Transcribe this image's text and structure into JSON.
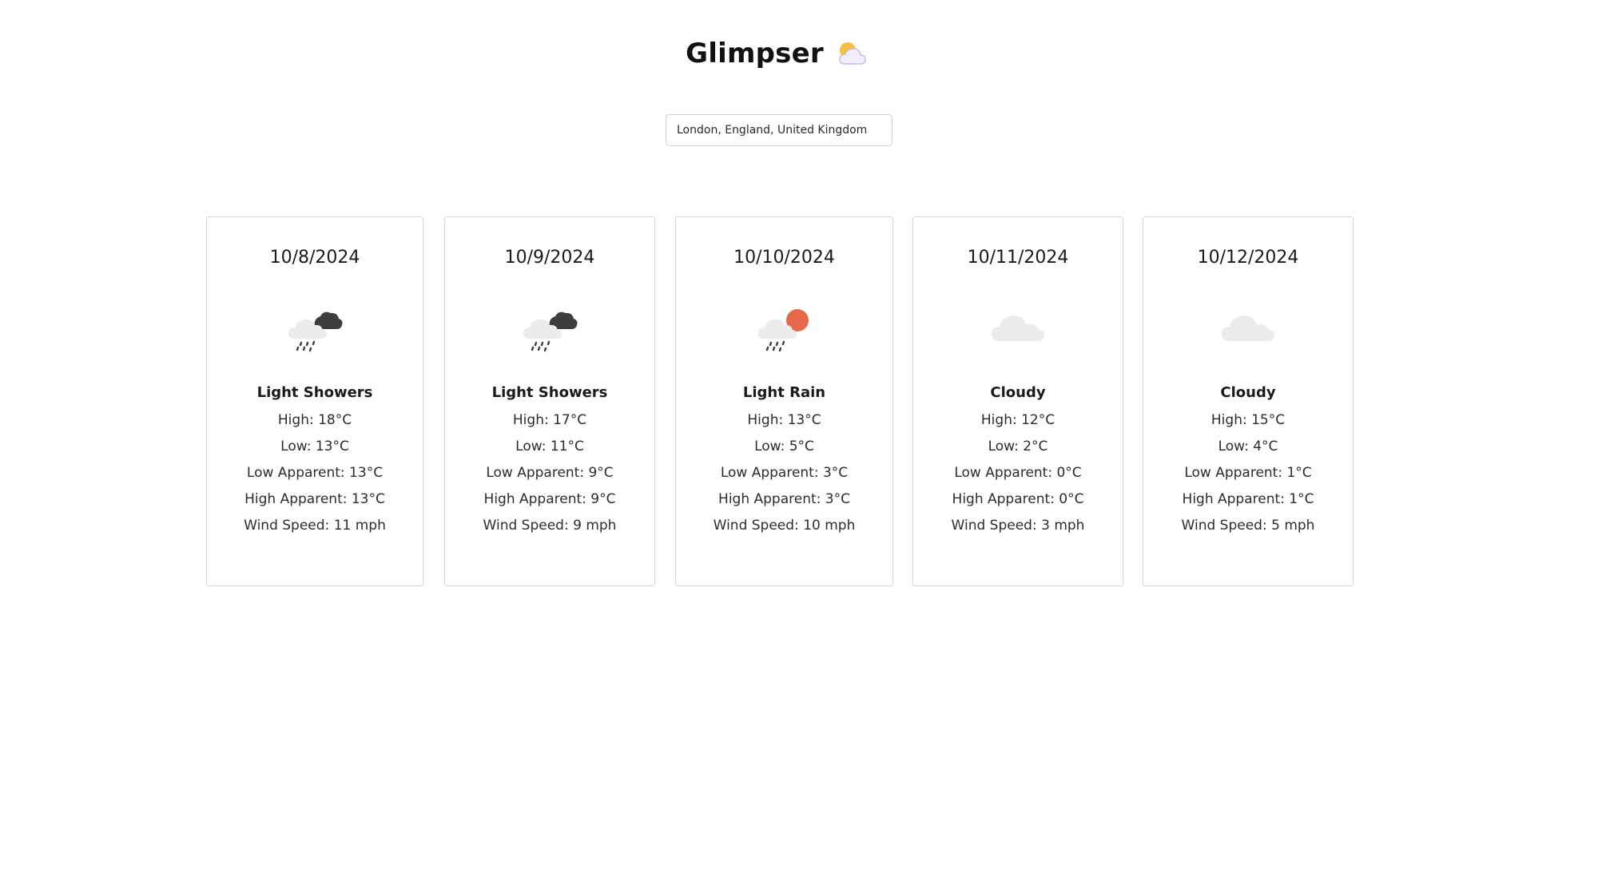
{
  "header": {
    "title": "Glimpser",
    "icon": "sun-behind-cloud-icon"
  },
  "search": {
    "value": "London, England, United Kingdom"
  },
  "labels": {
    "high": "High: ",
    "low": "Low: ",
    "low_apparent": "Low Apparent: ",
    "high_apparent": "High Apparent: ",
    "wind_speed": "Wind Speed: "
  },
  "forecast": [
    {
      "date": "10/8/2024",
      "icon": "heavy-cloud-rain-icon",
      "condition": "Light Showers",
      "high": "High: 18°C",
      "low": "Low: 13°C",
      "low_apparent": "Low Apparent: 13°C",
      "high_apparent": "High Apparent: 13°C",
      "wind_speed": "Wind Speed: 11 mph"
    },
    {
      "date": "10/9/2024",
      "icon": "heavy-cloud-rain-icon",
      "condition": "Light Showers",
      "high": "High: 17°C",
      "low": "Low: 11°C",
      "low_apparent": "Low Apparent: 9°C",
      "high_apparent": "High Apparent: 9°C",
      "wind_speed": "Wind Speed: 9 mph"
    },
    {
      "date": "10/10/2024",
      "icon": "sun-cloud-rain-icon",
      "condition": "Light Rain",
      "high": "High: 13°C",
      "low": "Low: 5°C",
      "low_apparent": "Low Apparent: 3°C",
      "high_apparent": "High Apparent: 3°C",
      "wind_speed": "Wind Speed: 10 mph"
    },
    {
      "date": "10/11/2024",
      "icon": "cloud-icon",
      "condition": "Cloudy",
      "high": "High: 12°C",
      "low": "Low: 2°C",
      "low_apparent": "Low Apparent: 0°C",
      "high_apparent": "High Apparent: 0°C",
      "wind_speed": "Wind Speed: 3 mph"
    },
    {
      "date": "10/12/2024",
      "icon": "cloud-icon",
      "condition": "Cloudy",
      "high": "High: 15°C",
      "low": "Low: 4°C",
      "low_apparent": "Low Apparent: 1°C",
      "high_apparent": "High Apparent: 1°C",
      "wind_speed": "Wind Speed: 5 mph"
    }
  ],
  "colors": {
    "card_border": "#d8d8d8",
    "sun_orange": "#e8684a",
    "dark_cloud": "#3d3d3d",
    "light_cloud": "#ececec"
  }
}
